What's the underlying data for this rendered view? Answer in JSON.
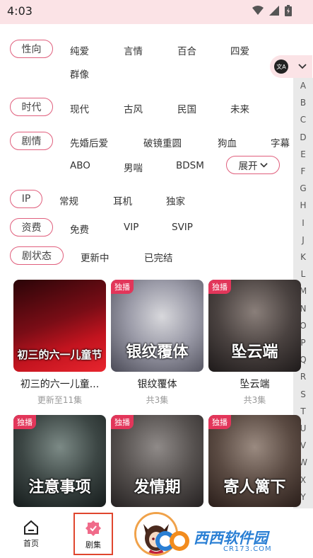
{
  "status_bar": {
    "time": "4:03"
  },
  "filters": {
    "orientation": {
      "label": "性向",
      "options": [
        "纯爱",
        "言情",
        "百合",
        "四爱",
        "群像"
      ]
    },
    "era": {
      "label": "时代",
      "options": [
        "现代",
        "古风",
        "民国",
        "未来"
      ]
    },
    "plot": {
      "label": "剧情",
      "options": [
        "先婚后爱",
        "破镜重圆",
        "狗血",
        "字幕",
        "ABO",
        "男喘",
        "BDSM"
      ],
      "expand_label": "展开"
    },
    "ip": {
      "label": "IP",
      "options": [
        "常规",
        "耳机",
        "独家"
      ]
    },
    "fee": {
      "label": "资费",
      "options": [
        "免费",
        "VIP",
        "SVIP"
      ]
    },
    "status": {
      "label": "剧状态",
      "options": [
        "更新中",
        "已完结"
      ]
    }
  },
  "index_letters": [
    "A",
    "B",
    "C",
    "D",
    "E",
    "F",
    "G",
    "H",
    "I",
    "J",
    "K",
    "L",
    "M",
    "N",
    "O",
    "P",
    "Q",
    "R",
    "S",
    "T",
    "U",
    "V",
    "W",
    "X",
    "Y"
  ],
  "lang_toggle": {
    "icon_text": "文A"
  },
  "cards": [
    {
      "badge": "",
      "cover_text": "初三的六一儿童节",
      "title": "初三的六一儿童...",
      "subtitle": "更新至11集"
    },
    {
      "badge": "独播",
      "cover_text": "银纹覆体",
      "title": "银纹覆体",
      "subtitle": "共3集"
    },
    {
      "badge": "独播",
      "cover_text": "坠云端",
      "title": "坠云端",
      "subtitle": "共3集"
    },
    {
      "badge": "独播",
      "cover_text": "注意事项",
      "title": "",
      "subtitle": ""
    },
    {
      "badge": "独播",
      "cover_text": "发情期",
      "title": "",
      "subtitle": ""
    },
    {
      "badge": "独播",
      "cover_text": "寄人篱下",
      "title": "",
      "subtitle": ""
    }
  ],
  "nav": {
    "home_label": "首页",
    "drama_label": "剧集"
  },
  "watermark": {
    "text": "西西软件园",
    "sub": "CR173.COM"
  },
  "colors": {
    "accent": "#e05f7d",
    "badge": "#e2365a",
    "status_bar": "#fbe3e6",
    "index_bar": "#e9e9e9"
  }
}
